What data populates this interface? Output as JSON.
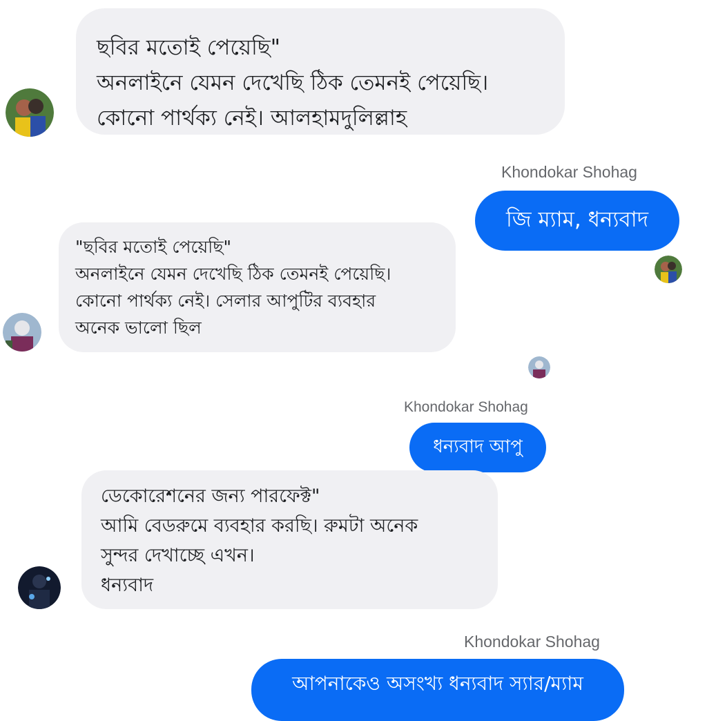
{
  "messages": [
    {
      "direction": "incoming",
      "text": "ছবির মতোই পেয়েছি\"\nঅনলাইনে যেমন দেখেছি ঠিক তেমনই পেয়েছি।\nকোনো পার্থক্য নেই। আলহামদুলিল্লাহ"
    },
    {
      "direction": "outgoing",
      "sender": "Khondokar Shohag",
      "text": "জি ম্যাম, ধন্যবাদ"
    },
    {
      "direction": "incoming",
      "text": "\"ছবির মতোই পেয়েছি\"\nঅনলাইনে যেমন দেখেছি ঠিক তেমনই পেয়েছি।\nকোনো পার্থক্য নেই। সেলার আপুটির ব্যবহার\nঅনেক ভালো ছিল"
    },
    {
      "direction": "outgoing",
      "sender": "Khondokar Shohag",
      "text": "ধন্যবাদ আপু"
    },
    {
      "direction": "incoming",
      "text": "ডেকোরেশনের জন্য পারফেক্ট\"\nআমি বেডরুমে ব্যবহার করছি। রুমটা অনেক\nসুন্দর দেখাচ্ছে এখন।\nধন্যবাদ"
    },
    {
      "direction": "outgoing",
      "sender": "Khondokar Shohag",
      "text": "আপনাকেও অসংখ্য ধন্যবাদ স্যার/ম্যাম"
    }
  ],
  "colors": {
    "outgoing_bubble": "#0a6cf5",
    "incoming_bubble": "#f0f0f3",
    "sender_name": "#65676b"
  }
}
